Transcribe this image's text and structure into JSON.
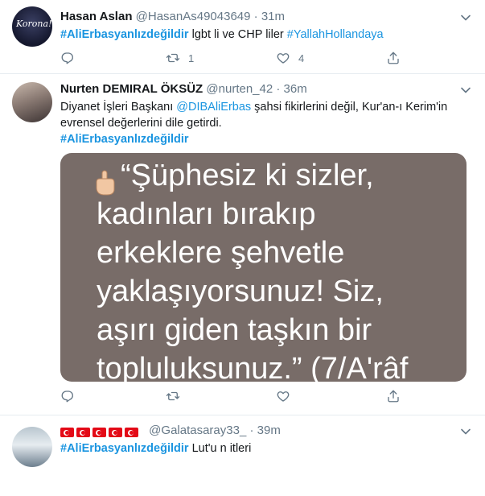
{
  "tweets": [
    {
      "name": "Hasan Aslan",
      "handle": "@HasanAs49043649",
      "time": "31m",
      "avatar_text": "Korona!",
      "text_parts": [
        {
          "t": "#AliErbasyanlızdeğildir",
          "k": "tag"
        },
        {
          "t": " lgbt li ve CHP liler ",
          "k": "plain"
        },
        {
          "t": "#YallahHollandaya",
          "k": "hashtag-link"
        }
      ],
      "reply_count": "",
      "retweet_count": "1",
      "like_count": "4"
    },
    {
      "name": "Nurten DEMIRAL ÖKSÜZ",
      "handle": "@nurten_42",
      "time": "36m",
      "text_line1_a": "Diyanet İşleri Başkanı ",
      "mention": "@DIBAliErbas",
      "text_line1_b": " şahsi fikirlerini değil, Kur'an-ı Kerim'in",
      "text_line2": "evrensel değerlerini dile getirdi.",
      "hashtag": "#AliErbasyanlızdeğildir",
      "card_lines": [
        "“Şüphesiz ki sizler,",
        "kadınları bırakıp",
        "erkeklere şehvetle",
        "yaklaşıyorsunuz! Siz,",
        "aşırı giden taşkın bir",
        "topluluksunuz.” (7/A'râf"
      ],
      "card_color": "#786c68",
      "reply_count": "",
      "retweet_count": "",
      "like_count": ""
    },
    {
      "name_flags": 5,
      "handle": "@Galatasaray33_",
      "time": "39m",
      "hashtag": "#AliErbasyanlızdeğildir",
      "text": " Lut'u n itleri"
    }
  ],
  "dot": "·",
  "accent": "#1b95e0",
  "icons": [
    "chevron-down-icon",
    "reply-icon",
    "retweet-icon",
    "like-icon",
    "share-icon",
    "pointing-finger-icon"
  ]
}
